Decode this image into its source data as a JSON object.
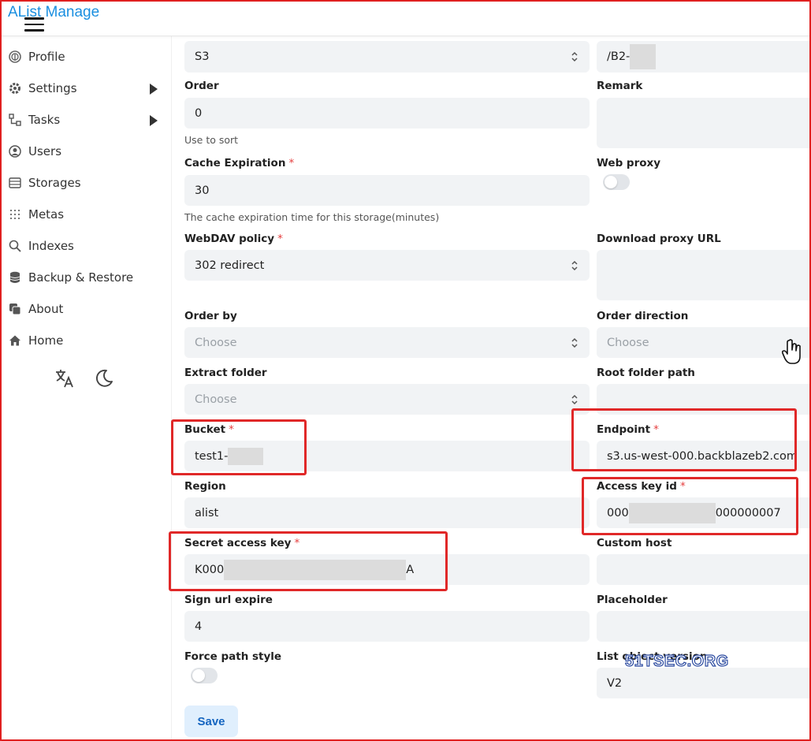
{
  "header": {
    "title": "AList Manage"
  },
  "sidebar": {
    "items": [
      {
        "label": "Profile",
        "icon": "fingerprint-icon"
      },
      {
        "label": "Settings",
        "icon": "gear-icon"
      },
      {
        "label": "Tasks",
        "icon": "tasks-icon"
      },
      {
        "label": "Users",
        "icon": "user-circle-icon"
      },
      {
        "label": "Storages",
        "icon": "storage-icon"
      },
      {
        "label": "Metas",
        "icon": "metas-icon"
      },
      {
        "label": "Indexes",
        "icon": "search-icon"
      },
      {
        "label": "Backup & Restore",
        "icon": "database-icon"
      },
      {
        "label": "About",
        "icon": "about-icon"
      },
      {
        "label": "Home",
        "icon": "home-icon"
      }
    ],
    "tools": [
      "translate-icon",
      "moon-icon"
    ]
  },
  "form": {
    "driver_value": "S3",
    "mount_path_value": "/B2-",
    "order_label": "Order",
    "order_value": "0",
    "order_help": "Use to sort",
    "remark_label": "Remark",
    "cache_label": "Cache Expiration",
    "cache_value": "30",
    "cache_help": "The cache expiration time for this storage(minutes)",
    "web_proxy_label": "Web proxy",
    "webdav_label": "WebDAV policy",
    "webdav_value": "302 redirect",
    "download_proxy_label": "Download proxy URL",
    "order_by_label": "Order by",
    "order_by_value": "Choose",
    "order_direction_label": "Order direction",
    "order_direction_value": "Choose",
    "extract_folder_label": "Extract folder",
    "extract_folder_value": "Choose",
    "root_folder_label": "Root folder path",
    "bucket_label": "Bucket",
    "bucket_value": "test1-",
    "endpoint_label": "Endpoint",
    "endpoint_value": "s3.us-west-000.backblazeb2.com",
    "region_label": "Region",
    "region_value": "alist",
    "access_key_label": "Access key id",
    "access_key_prefix": "000",
    "access_key_suffix": "000000007",
    "secret_key_label": "Secret access key",
    "secret_key_prefix": "K000",
    "secret_key_suffix": "A",
    "custom_host_label": "Custom host",
    "sign_url_label": "Sign url expire",
    "sign_url_value": "4",
    "placeholder_label": "Placeholder",
    "force_path_label": "Force path style",
    "list_version_label": "List object version",
    "list_version_value": "V2",
    "save_label": "Save"
  },
  "watermark": "51TSEC.ORG",
  "colors": {
    "brand": "#1a8fe0",
    "highlight": "#e02828",
    "required": "#e53e3e",
    "save_bg": "#e0effd"
  }
}
